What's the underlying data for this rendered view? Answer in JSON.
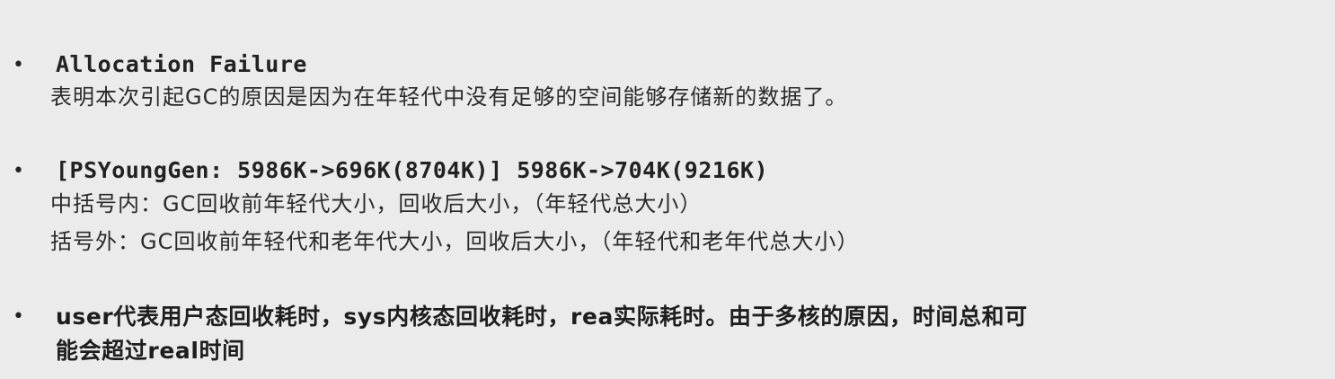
{
  "bullets": [
    {
      "marker": "•",
      "heading": "Allocation Failure",
      "lines": [
        "表明本次引起GC的原因是因为在年轻代中没有足够的空间能够存储新的数据了。"
      ]
    },
    {
      "marker": "•",
      "heading": "[PSYoungGen: 5986K->696K(8704K)] 5986K->704K(9216K)",
      "lines": [
        "中括号内：GC回收前年轻代大小，回收后大小，（年轻代总大小）",
        "括号外：GC回收前年轻代和老年代大小，回收后大小，（年轻代和老年代总大小）"
      ]
    },
    {
      "marker": "•",
      "lines": [
        "user代表用户态回收耗时，sys内核态回收耗时，rea实际耗时。由于多核的原因，时间总和可",
        "能会超过real时间"
      ]
    }
  ]
}
